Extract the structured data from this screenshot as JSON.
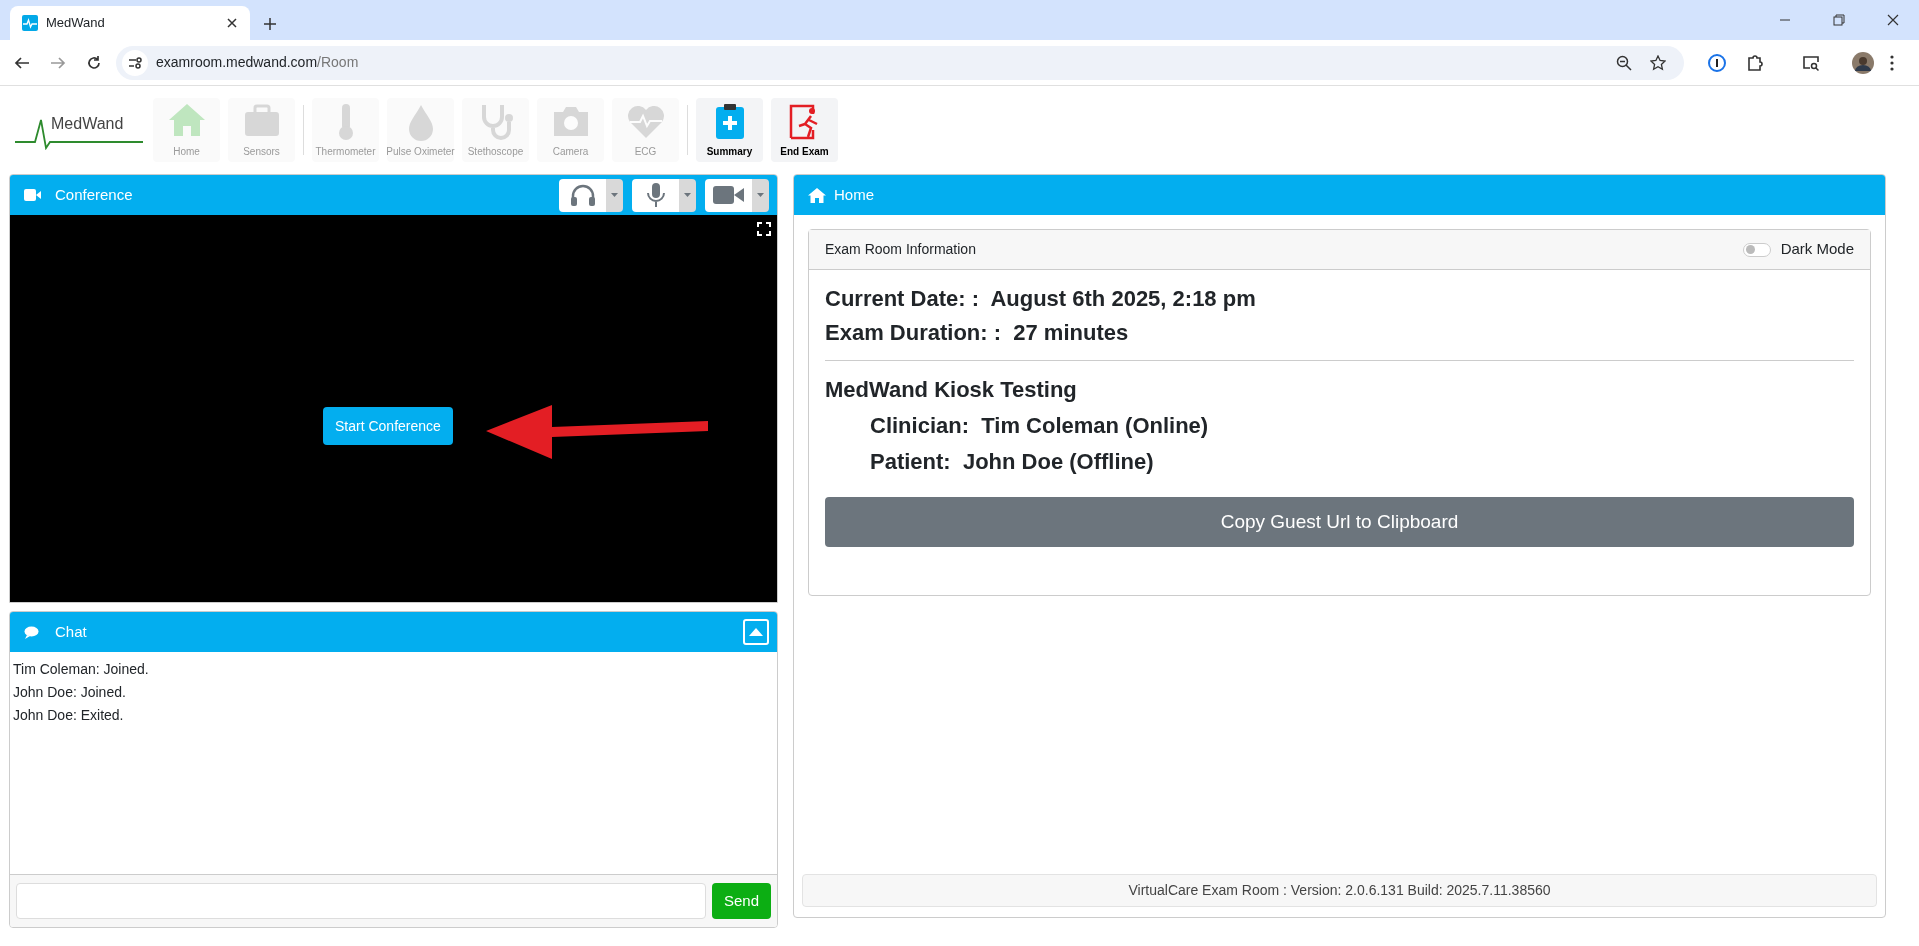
{
  "browser": {
    "tab_title": "MedWand",
    "url_host": "examroom.medwand.com",
    "url_path": "/Room"
  },
  "toolbar": [
    {
      "kind": "home",
      "label": "Home",
      "disabled": true
    },
    {
      "kind": "sensors",
      "label": "Sensors",
      "disabled": true
    },
    {
      "kind": "thermometer",
      "label": "Thermometer",
      "disabled": true
    },
    {
      "kind": "oximeter",
      "label": "Pulse Oximeter",
      "disabled": true
    },
    {
      "kind": "stethoscope",
      "label": "Stethoscope",
      "disabled": true
    },
    {
      "kind": "camera",
      "label": "Camera",
      "disabled": true
    },
    {
      "kind": "ecg",
      "label": "ECG",
      "disabled": true
    },
    {
      "kind": "summary",
      "label": "Summary",
      "disabled": false
    },
    {
      "kind": "exit",
      "label": "End Exam",
      "disabled": false
    }
  ],
  "logo": {
    "text": "MedWand"
  },
  "conference": {
    "title": "Conference",
    "devices": [
      {
        "kind": "headset"
      },
      {
        "kind": "microphone"
      },
      {
        "kind": "camera"
      }
    ],
    "start_button": "Start Conference"
  },
  "chat": {
    "title": "Chat",
    "messages": [
      "Tim Coleman: Joined.",
      "John Doe: Joined.",
      "John Doe: Exited."
    ],
    "send_button": "Send"
  },
  "home": {
    "title": "Home",
    "card_title": "Exam Room Information",
    "dark_mode": {
      "label": "Dark Mode",
      "on": false
    },
    "lines": [
      {
        "label": "Current Date: :",
        "value": "August 6th 2025, 2:18 pm"
      },
      {
        "label": "Exam Duration: :",
        "value": "27 minutes"
      }
    ],
    "room_name": "MedWand Kiosk Testing",
    "participants": [
      {
        "label": "Clinician:",
        "value": "Tim Coleman (Online)"
      },
      {
        "label": "Patient:",
        "value": "John Doe (Offline)"
      }
    ],
    "copy_button": "Copy Guest Url to Clipboard",
    "version": "VirtualCare Exam Room : Version: 2.0.6.131 Build: 2025.7.11.38560"
  }
}
